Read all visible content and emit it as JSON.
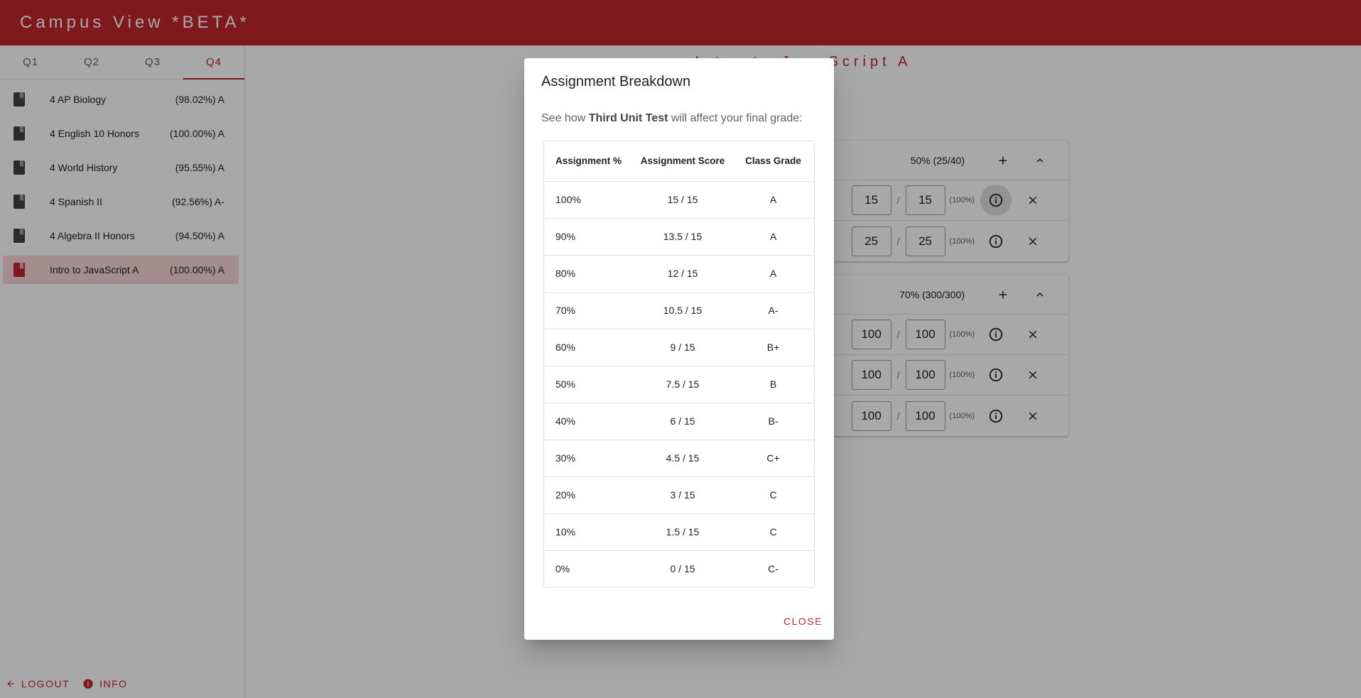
{
  "app": {
    "title": "Campus View *BETA*"
  },
  "sidebar": {
    "tabs": [
      {
        "label": "Q1"
      },
      {
        "label": "Q2"
      },
      {
        "label": "Q3"
      },
      {
        "label": "Q4",
        "active": true
      }
    ],
    "classes": [
      {
        "name": "4 AP Biology",
        "grade": "(98.02%) A"
      },
      {
        "name": "4 English 10 Honors",
        "grade": "(100.00%) A"
      },
      {
        "name": "4 World History",
        "grade": "(95.55%) A"
      },
      {
        "name": "4 Spanish II",
        "grade": "(92.56%) A-"
      },
      {
        "name": "4 Algebra II Honors",
        "grade": "(94.50%) A"
      },
      {
        "name": "Intro to JavaScript A",
        "grade": "(100.00%) A",
        "active": true
      }
    ],
    "footer": {
      "logout_label": "LOGOUT",
      "info_label": "INFO"
    }
  },
  "main": {
    "page_title": "Intro to JavaScript A",
    "categories": [
      {
        "summary": "50% (25/40)",
        "assignments": [
          {
            "earned": "15",
            "possible": "15",
            "percent": "(100%)"
          },
          {
            "earned": "25",
            "possible": "25",
            "percent": "(100%)"
          }
        ]
      },
      {
        "summary": "70% (300/300)",
        "assignments": [
          {
            "earned": "100",
            "possible": "100",
            "percent": "(100%)"
          },
          {
            "earned": "100",
            "possible": "100",
            "percent": "(100%)"
          },
          {
            "earned": "100",
            "possible": "100",
            "percent": "(100%)"
          }
        ]
      }
    ]
  },
  "dialog": {
    "title": "Assignment Breakdown",
    "text_prefix": "See how ",
    "assignment_name": "Third Unit Test",
    "text_suffix": " will affect your final grade:",
    "columns": [
      "Assignment %",
      "Assignment Score",
      "Class Grade"
    ],
    "rows": [
      [
        "100%",
        "15 / 15",
        "A"
      ],
      [
        "90%",
        "13.5 / 15",
        "A"
      ],
      [
        "80%",
        "12 / 15",
        "A"
      ],
      [
        "70%",
        "10.5 / 15",
        "A-"
      ],
      [
        "60%",
        "9 / 15",
        "B+"
      ],
      [
        "50%",
        "7.5 / 15",
        "B"
      ],
      [
        "40%",
        "6 / 15",
        "B-"
      ],
      [
        "30%",
        "4.5 / 15",
        "C+"
      ],
      [
        "20%",
        "3 / 15",
        "C"
      ],
      [
        "10%",
        "1.5 / 15",
        "C"
      ],
      [
        "0%",
        "0 / 15",
        "C-"
      ]
    ],
    "close_label": "CLOSE"
  },
  "colors": {
    "primary": "#c2272d",
    "active_item_bg": "#f8d7d9",
    "scrim": "rgba(0,0,0,0.34)"
  }
}
